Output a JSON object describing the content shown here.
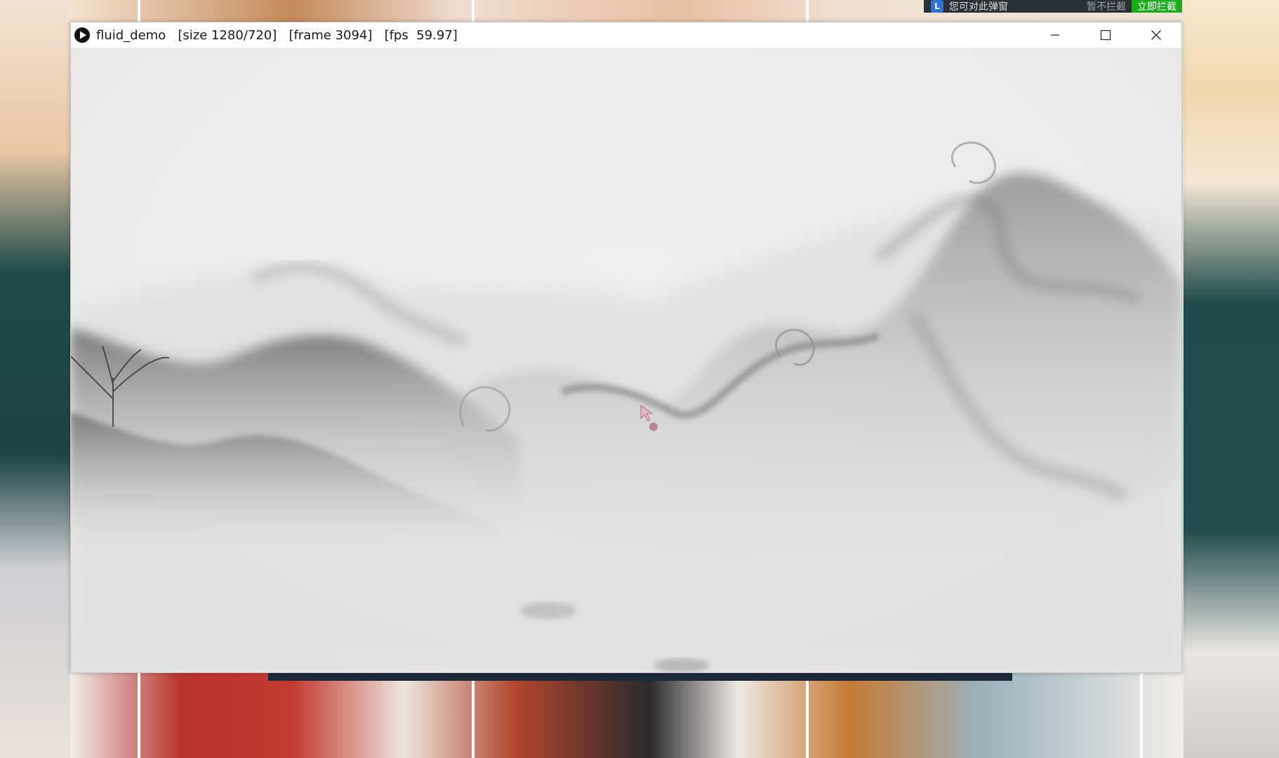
{
  "window": {
    "title": "fluid_demo   [size 1280/720]   [frame 3094]   [fps  59.97]",
    "app_icon": "play-circle-icon",
    "controls": {
      "minimize_icon": "minimize-icon",
      "maximize_icon": "maximize-icon",
      "close_icon": "close-icon"
    }
  },
  "notification": {
    "logo_letter": "L",
    "message": "您可对此弹窗",
    "dismiss_label": "暂不拦截",
    "block_label": "立即拦截",
    "colors": {
      "background": "#2b3036",
      "block_button": "#1aad19"
    }
  },
  "canvas": {
    "description_icon": "ink-fluid-simulation",
    "cursor_icon": "arrow-cursor-icon"
  },
  "colors": {
    "ink_dark": "#5a5a5a",
    "ink_mid": "#9a9a9a",
    "paper": "#efefef"
  }
}
